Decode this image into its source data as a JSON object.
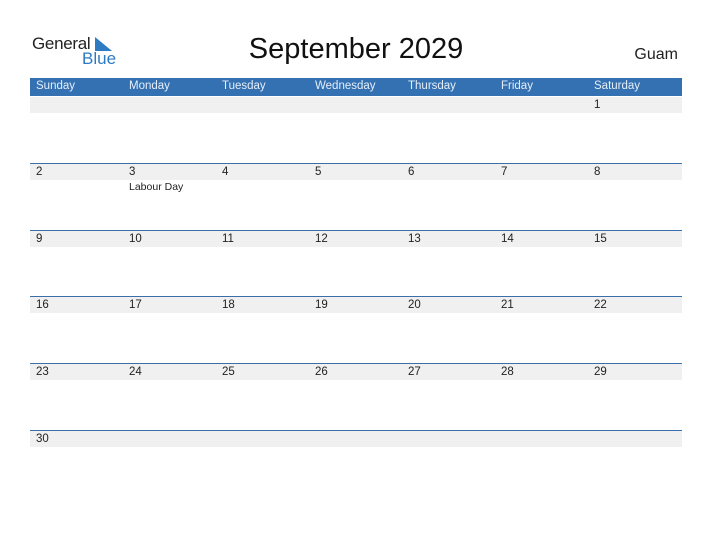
{
  "logo": {
    "general": "General",
    "blue": "Blue",
    "icon": "triangle-flag-icon",
    "brand_color": "#2e7bc4"
  },
  "title": "September 2029",
  "region": "Guam",
  "colors": {
    "header_bg": "#3371b2",
    "strip_bg": "#f0f0f0",
    "row_border": "#3a70a8"
  },
  "weekdays": [
    "Sunday",
    "Monday",
    "Tuesday",
    "Wednesday",
    "Thursday",
    "Friday",
    "Saturday"
  ],
  "weeks": [
    [
      "",
      "",
      "",
      "",
      "",
      "",
      "1"
    ],
    [
      "2",
      "3",
      "4",
      "5",
      "6",
      "7",
      "8"
    ],
    [
      "9",
      "10",
      "11",
      "12",
      "13",
      "14",
      "15"
    ],
    [
      "16",
      "17",
      "18",
      "19",
      "20",
      "21",
      "22"
    ],
    [
      "23",
      "24",
      "25",
      "26",
      "27",
      "28",
      "29"
    ],
    [
      "30",
      "",
      "",
      "",
      "",
      "",
      ""
    ]
  ],
  "events": [
    {
      "week": 1,
      "day": 1,
      "label": "Labour Day"
    }
  ]
}
